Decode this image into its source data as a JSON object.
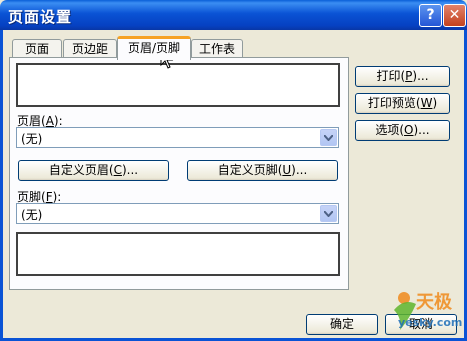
{
  "window": {
    "title": "页面设置"
  },
  "titlebar": {
    "help_glyph": "?",
    "close_glyph": "✕"
  },
  "tabs": [
    {
      "label": "页面"
    },
    {
      "label": "页边距"
    },
    {
      "label": "页眉/页脚"
    },
    {
      "label": "工作表"
    }
  ],
  "header": {
    "label_pre": "页眉(",
    "label_key": "A",
    "label_post": "):",
    "selected": "(无)",
    "custom_pre": "自定义页眉(",
    "custom_key": "C",
    "custom_post": ")..."
  },
  "footer": {
    "label_pre": "页脚(",
    "label_key": "F",
    "label_post": "):",
    "selected": "(无)",
    "custom_pre": "自定义页脚(",
    "custom_key": "U",
    "custom_post": ")..."
  },
  "side_buttons": {
    "print": {
      "pre": "打印(",
      "key": "P",
      "post": ")..."
    },
    "preview": {
      "pre": "打印预览(",
      "key": "W",
      "post": ")"
    },
    "options": {
      "pre": "选项(",
      "key": "O",
      "post": ")..."
    }
  },
  "footer_buttons": {
    "ok": "确定",
    "cancel": "取消"
  },
  "watermark": {
    "brand": "天极",
    "site": "yesky.com"
  }
}
